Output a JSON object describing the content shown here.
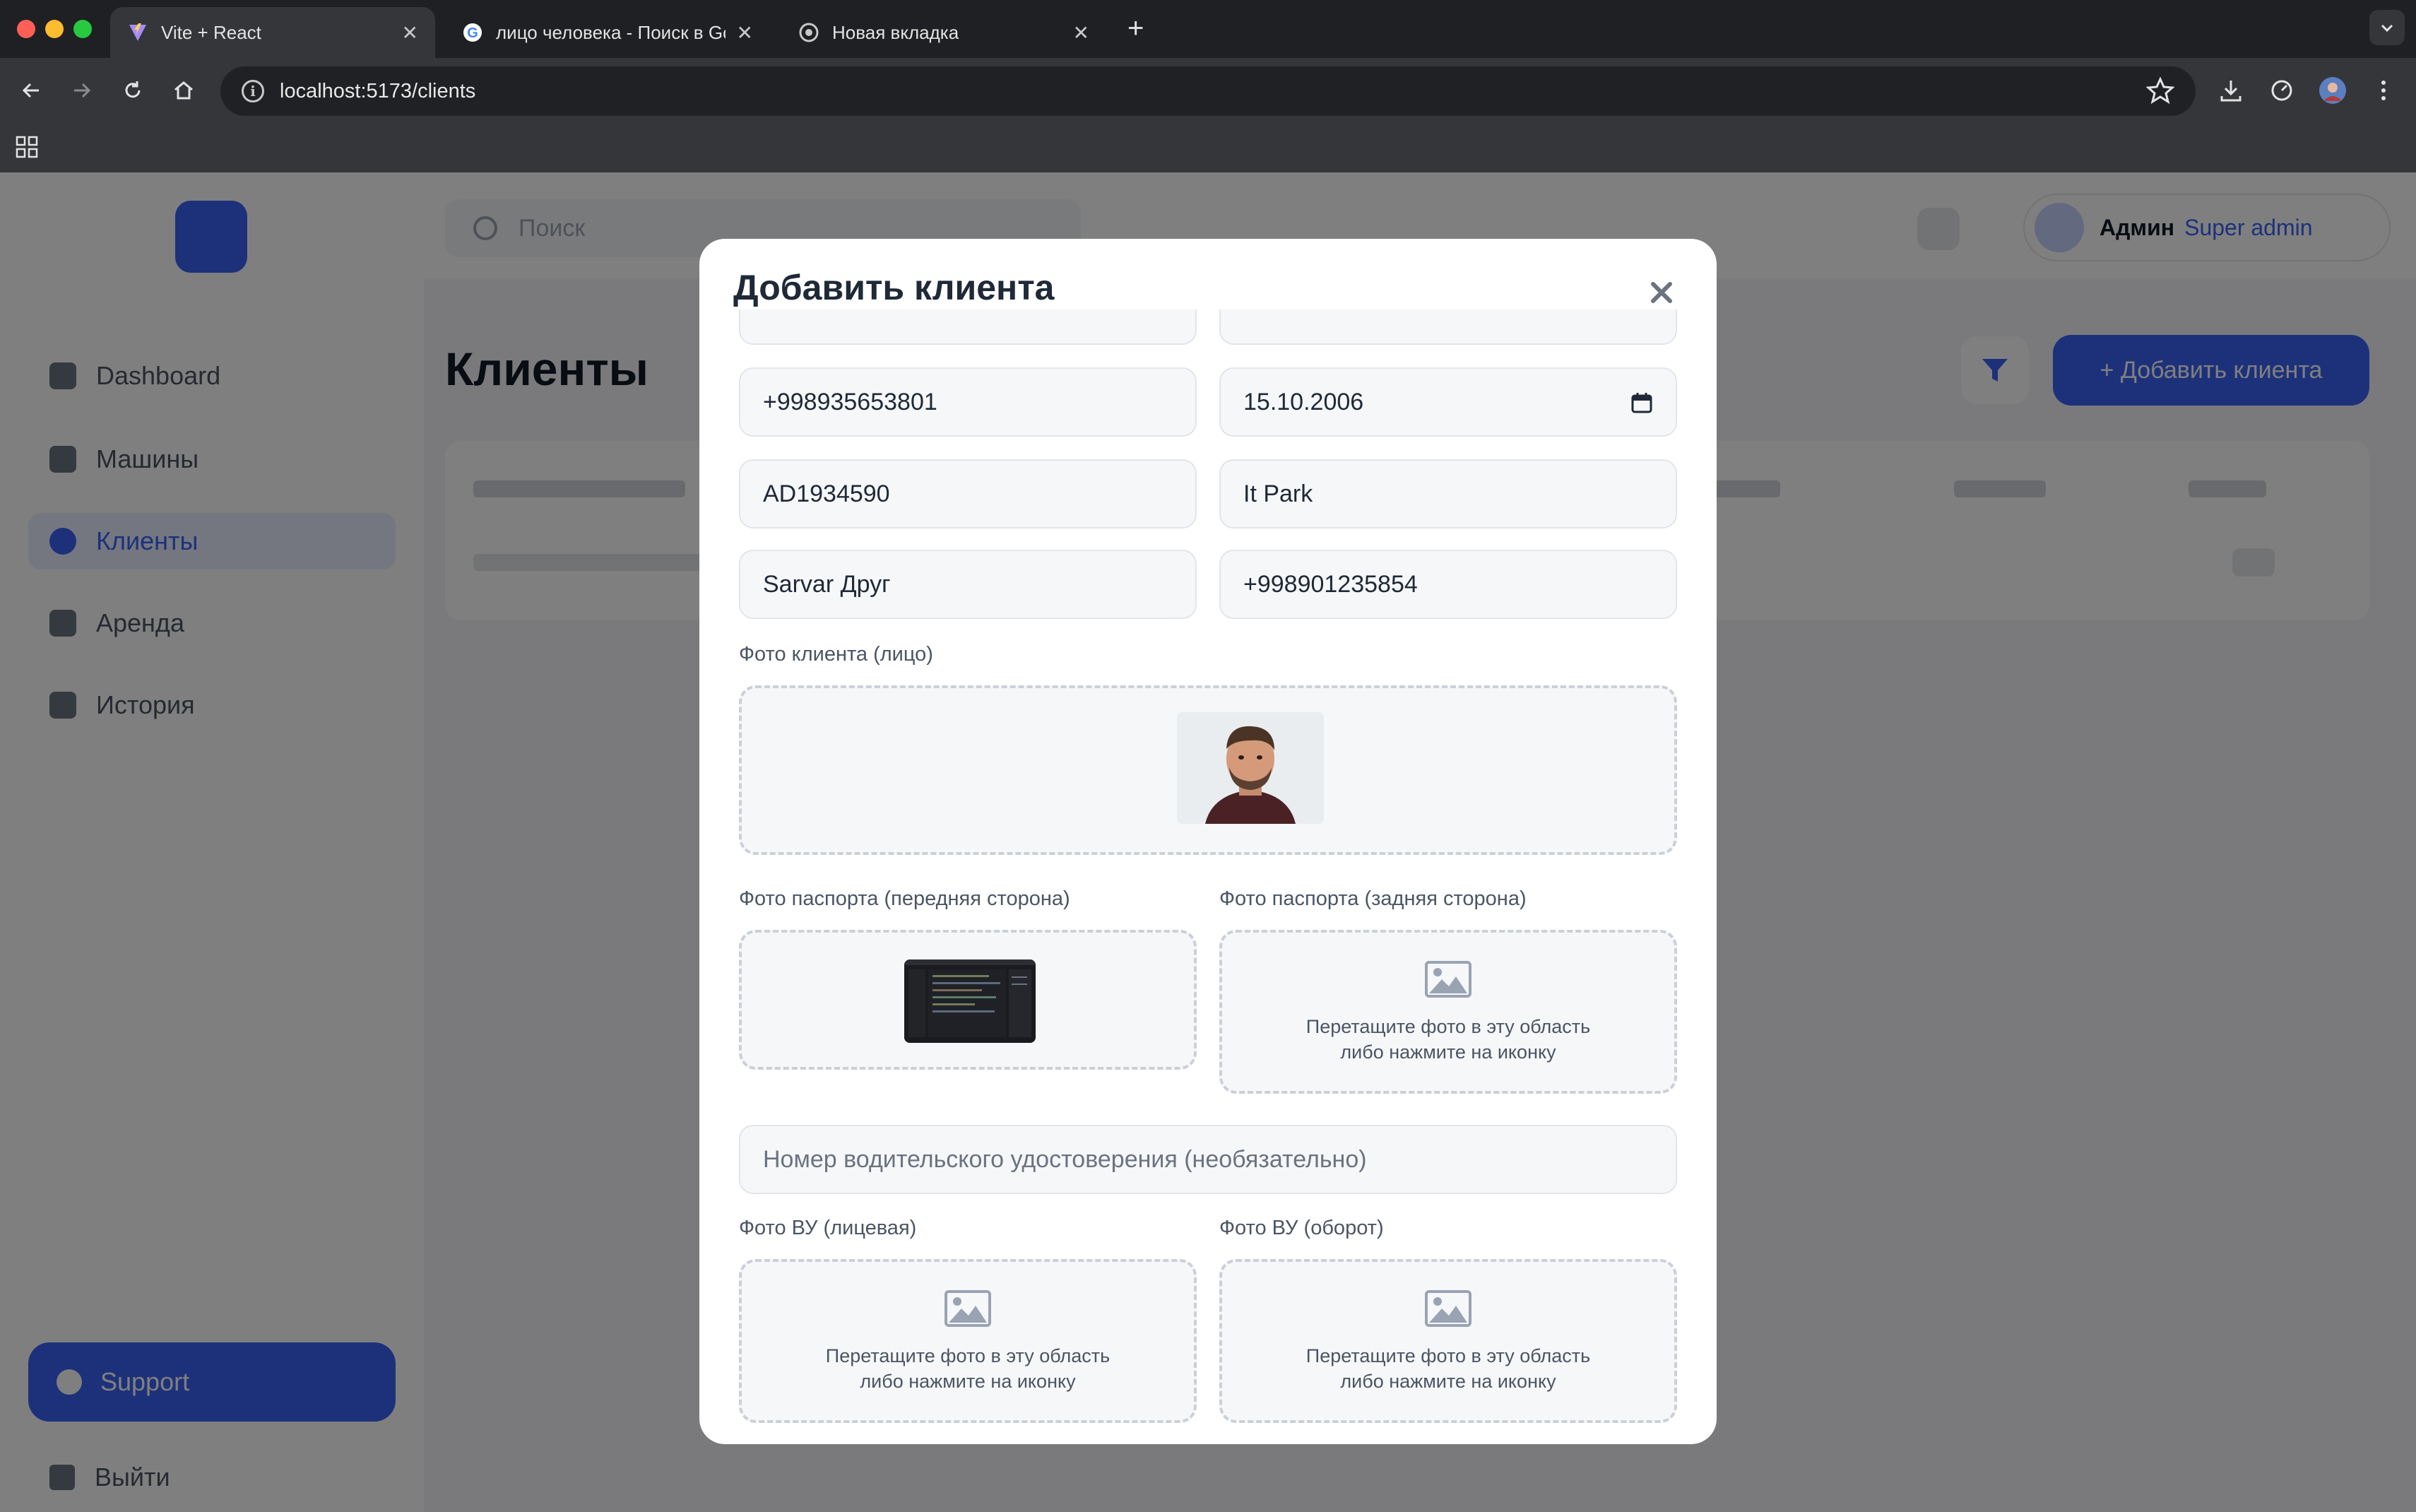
{
  "browser": {
    "tabs": [
      {
        "title": "Vite + React"
      },
      {
        "title": "лицо человека - Поиск в Google"
      },
      {
        "title": "Новая вкладка"
      }
    ],
    "url": "localhost:5173/clients"
  },
  "background": {
    "search_placeholder": "Поиск",
    "sidebar": [
      "Dashboard",
      "Машины",
      "Клиенты",
      "Аренда",
      "История"
    ],
    "support": "Support",
    "logout": "Выйти",
    "page_title": "Клиенты",
    "add_button": "+ Добавить клиента",
    "user_name": "Админ",
    "user_role": "Super admin"
  },
  "modal": {
    "title": "Добавить клиента",
    "phone": "+998935653801",
    "birth_date": "15.10.2006",
    "passport": "AD1934590",
    "work_place": "It Park",
    "contact_name": "Sarvar  Друг",
    "contact_phone": "+998901235854",
    "face_photo_label": "Фото клиента (лицо)",
    "passport_front_label": "Фото паспорта (передняя сторона)",
    "passport_back_label": "Фото паспорта (задняя сторона)",
    "drop_hint_line1": "Перетащите фото в эту область",
    "drop_hint_line2": "либо нажмите на иконку",
    "license_placeholder": "Номер водительского удостоверения (необязательно)",
    "license_front_label": "Фото ВУ (лицевая)",
    "license_back_label": "Фото ВУ (оборот)"
  }
}
